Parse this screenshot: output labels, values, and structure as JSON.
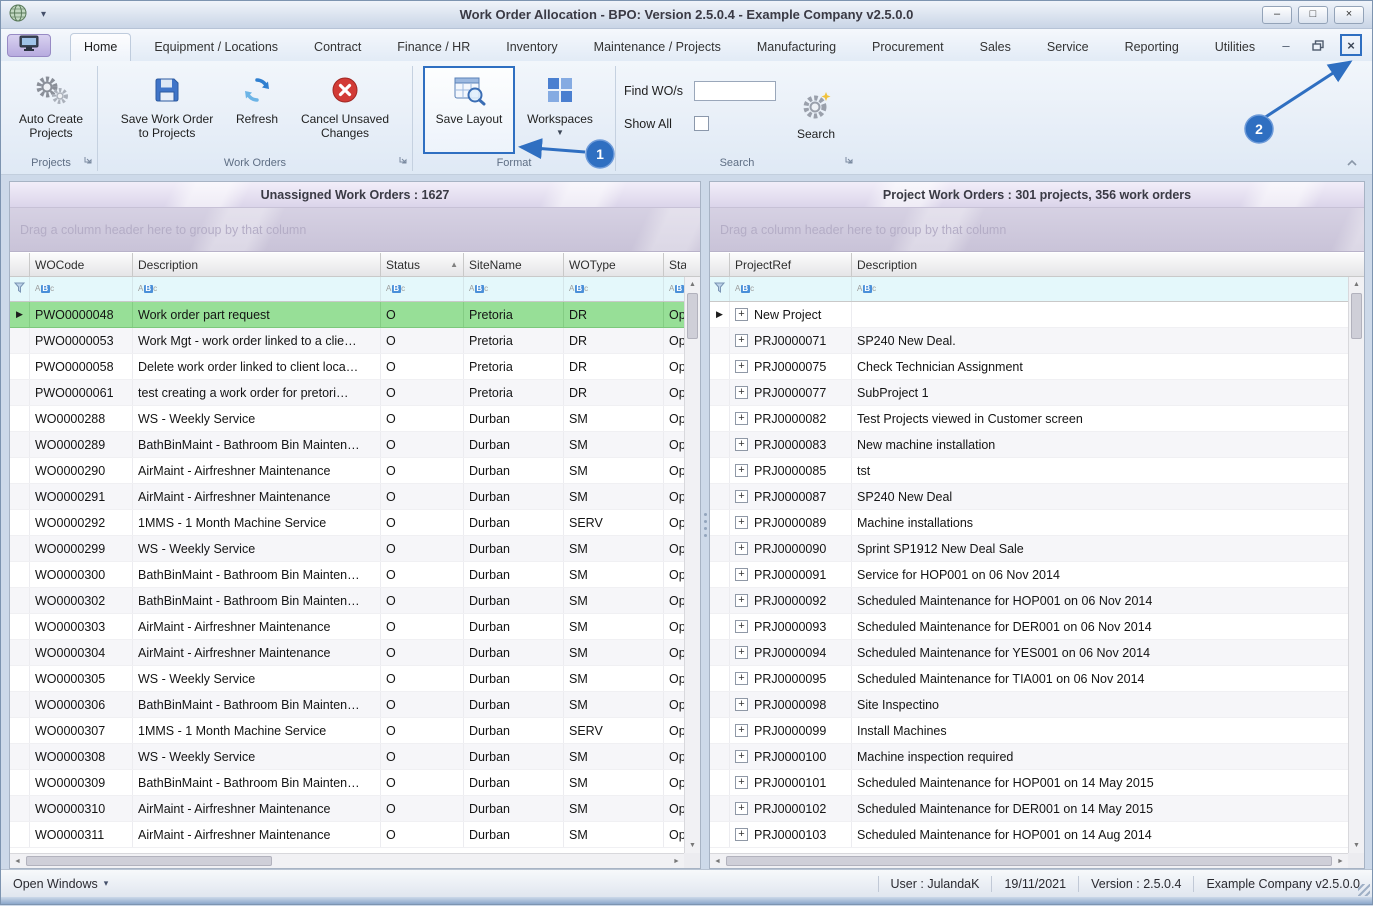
{
  "accent": "#2f6fc1",
  "window": {
    "title": "Work Order Allocation - BPO: Version 2.5.0.4 - Example Company v2.5.0.0"
  },
  "ribbon": {
    "tabs": [
      "Home",
      "Equipment / Locations",
      "Contract",
      "Finance / HR",
      "Inventory",
      "Maintenance / Projects",
      "Manufacturing",
      "Procurement",
      "Sales",
      "Service",
      "Reporting",
      "Utilities"
    ],
    "active_tab": "Home",
    "buttons": {
      "auto_create_projects": "Auto Create Projects",
      "save_wo_to_projects": "Save Work Order to Projects",
      "refresh": "Refresh",
      "cancel_unsaved": "Cancel Unsaved Changes",
      "save_layout": "Save Layout",
      "workspaces": "Workspaces",
      "search": "Search"
    },
    "fields": {
      "find_label": "Find WO/s",
      "find_value": "",
      "show_all_label": "Show All",
      "show_all_checked": false
    },
    "group_labels": {
      "projects": "Projects",
      "work_orders": "Work Orders",
      "format": "Format",
      "search": "Search"
    },
    "icons": {
      "auto_create_projects": "gears-icon",
      "save_wo_to_projects": "save-icon",
      "refresh": "refresh-icon",
      "cancel_unsaved": "cancel-icon",
      "save_layout": "save-layout-icon",
      "workspaces": "workspaces-grid-icon",
      "search": "search-gear-icon"
    }
  },
  "left_panel": {
    "title": "Unassigned Work Orders : 1627",
    "group_hint": "Drag a column header here to group by that column",
    "columns": [
      "WOCode",
      "Description",
      "Status",
      "SiteName",
      "WOType",
      "Status"
    ],
    "sorted_column": "Status",
    "sort_direction": "asc",
    "rows": [
      {
        "code": "PWO0000048",
        "desc": "Work order part request",
        "status": "O",
        "site": "Pretoria",
        "type": "DR",
        "status2": "Op",
        "selected": true
      },
      {
        "code": "PWO0000053",
        "desc": "Work Mgt - work order linked to a clie…",
        "status": "O",
        "site": "Pretoria",
        "type": "DR",
        "status2": "Op"
      },
      {
        "code": "PWO0000058",
        "desc": "Delete work order linked to client loca…",
        "status": "O",
        "site": "Pretoria",
        "type": "DR",
        "status2": "Op"
      },
      {
        "code": "PWO0000061",
        "desc": "test creating a work order for pretori…",
        "status": "O",
        "site": "Pretoria",
        "type": "DR",
        "status2": "Op"
      },
      {
        "code": "WO0000288",
        "desc": "WS - Weekly Service",
        "status": "O",
        "site": "Durban",
        "type": "SM",
        "status2": "Op"
      },
      {
        "code": "WO0000289",
        "desc": "BathBinMaint - Bathroom Bin Mainten…",
        "status": "O",
        "site": "Durban",
        "type": "SM",
        "status2": "Op"
      },
      {
        "code": "WO0000290",
        "desc": "AirMaint - Airfreshner Maintenance",
        "status": "O",
        "site": "Durban",
        "type": "SM",
        "status2": "Op"
      },
      {
        "code": "WO0000291",
        "desc": "AirMaint - Airfreshner Maintenance",
        "status": "O",
        "site": "Durban",
        "type": "SM",
        "status2": "Op"
      },
      {
        "code": "WO0000292",
        "desc": "1MMS - 1 Month Machine Service",
        "status": "O",
        "site": "Durban",
        "type": "SERV",
        "status2": "Op"
      },
      {
        "code": "WO0000299",
        "desc": "WS - Weekly Service",
        "status": "O",
        "site": "Durban",
        "type": "SM",
        "status2": "Op"
      },
      {
        "code": "WO0000300",
        "desc": "BathBinMaint - Bathroom Bin Mainten…",
        "status": "O",
        "site": "Durban",
        "type": "SM",
        "status2": "Op"
      },
      {
        "code": "WO0000302",
        "desc": "BathBinMaint - Bathroom Bin Mainten…",
        "status": "O",
        "site": "Durban",
        "type": "SM",
        "status2": "Op"
      },
      {
        "code": "WO0000303",
        "desc": "AirMaint - Airfreshner Maintenance",
        "status": "O",
        "site": "Durban",
        "type": "SM",
        "status2": "Op"
      },
      {
        "code": "WO0000304",
        "desc": "AirMaint - Airfreshner Maintenance",
        "status": "O",
        "site": "Durban",
        "type": "SM",
        "status2": "Op"
      },
      {
        "code": "WO0000305",
        "desc": "WS - Weekly Service",
        "status": "O",
        "site": "Durban",
        "type": "SM",
        "status2": "Op"
      },
      {
        "code": "WO0000306",
        "desc": "BathBinMaint - Bathroom Bin Mainten…",
        "status": "O",
        "site": "Durban",
        "type": "SM",
        "status2": "Op"
      },
      {
        "code": "WO0000307",
        "desc": "1MMS - 1 Month Machine Service",
        "status": "O",
        "site": "Durban",
        "type": "SERV",
        "status2": "Op"
      },
      {
        "code": "WO0000308",
        "desc": "WS - Weekly Service",
        "status": "O",
        "site": "Durban",
        "type": "SM",
        "status2": "Op"
      },
      {
        "code": "WO0000309",
        "desc": "BathBinMaint - Bathroom Bin Mainten…",
        "status": "O",
        "site": "Durban",
        "type": "SM",
        "status2": "Op"
      },
      {
        "code": "WO0000310",
        "desc": "AirMaint - Airfreshner Maintenance",
        "status": "O",
        "site": "Durban",
        "type": "SM",
        "status2": "Op"
      },
      {
        "code": "WO0000311",
        "desc": "AirMaint - Airfreshner Maintenance",
        "status": "O",
        "site": "Durban",
        "type": "SM",
        "status2": "Op"
      }
    ]
  },
  "right_panel": {
    "title": "Project Work Orders : 301 projects, 356 work orders",
    "group_hint": "Drag a column header here to group by that column",
    "columns": [
      "ProjectRef",
      "Description"
    ],
    "rows": [
      {
        "ref": "New Project",
        "desc": "",
        "pointer": true
      },
      {
        "ref": "PRJ0000071",
        "desc": "SP240 New Deal."
      },
      {
        "ref": "PRJ0000075",
        "desc": "Check Technician Assignment"
      },
      {
        "ref": "PRJ0000077",
        "desc": "SubProject 1"
      },
      {
        "ref": "PRJ0000082",
        "desc": "Test Projects viewed in Customer screen"
      },
      {
        "ref": "PRJ0000083",
        "desc": "New machine installation"
      },
      {
        "ref": "PRJ0000085",
        "desc": "tst"
      },
      {
        "ref": "PRJ0000087",
        "desc": "SP240 New Deal"
      },
      {
        "ref": "PRJ0000089",
        "desc": "Machine installations"
      },
      {
        "ref": "PRJ0000090",
        "desc": "Sprint SP1912 New Deal Sale"
      },
      {
        "ref": "PRJ0000091",
        "desc": "Service for HOP001 on 06 Nov 2014"
      },
      {
        "ref": "PRJ0000092",
        "desc": "Scheduled Maintenance for HOP001 on 06 Nov 2014"
      },
      {
        "ref": "PRJ0000093",
        "desc": "Scheduled Maintenance for DER001 on 06 Nov 2014"
      },
      {
        "ref": "PRJ0000094",
        "desc": "Scheduled Maintenance for YES001 on 06 Nov 2014"
      },
      {
        "ref": "PRJ0000095",
        "desc": "Scheduled Maintenance for TIA001 on 06 Nov 2014"
      },
      {
        "ref": "PRJ0000098",
        "desc": "Site Inspectino"
      },
      {
        "ref": "PRJ0000099",
        "desc": "Install Machines"
      },
      {
        "ref": "PRJ0000100",
        "desc": "Machine inspection required"
      },
      {
        "ref": "PRJ0000101",
        "desc": "Scheduled Maintenance for HOP001 on 14 May 2015"
      },
      {
        "ref": "PRJ0000102",
        "desc": "Scheduled Maintenance for DER001 on 14 May 2015"
      },
      {
        "ref": "PRJ0000103",
        "desc": "Scheduled Maintenance for HOP001 on 14 Aug 2014"
      }
    ]
  },
  "statusbar": {
    "open_windows": "Open Windows",
    "user": "User : JulandaK",
    "date": "19/11/2021",
    "version": "Version : 2.5.0.4",
    "company": "Example Company v2.5.0.0"
  },
  "annotations": {
    "badge1": "1",
    "badge2": "2"
  }
}
